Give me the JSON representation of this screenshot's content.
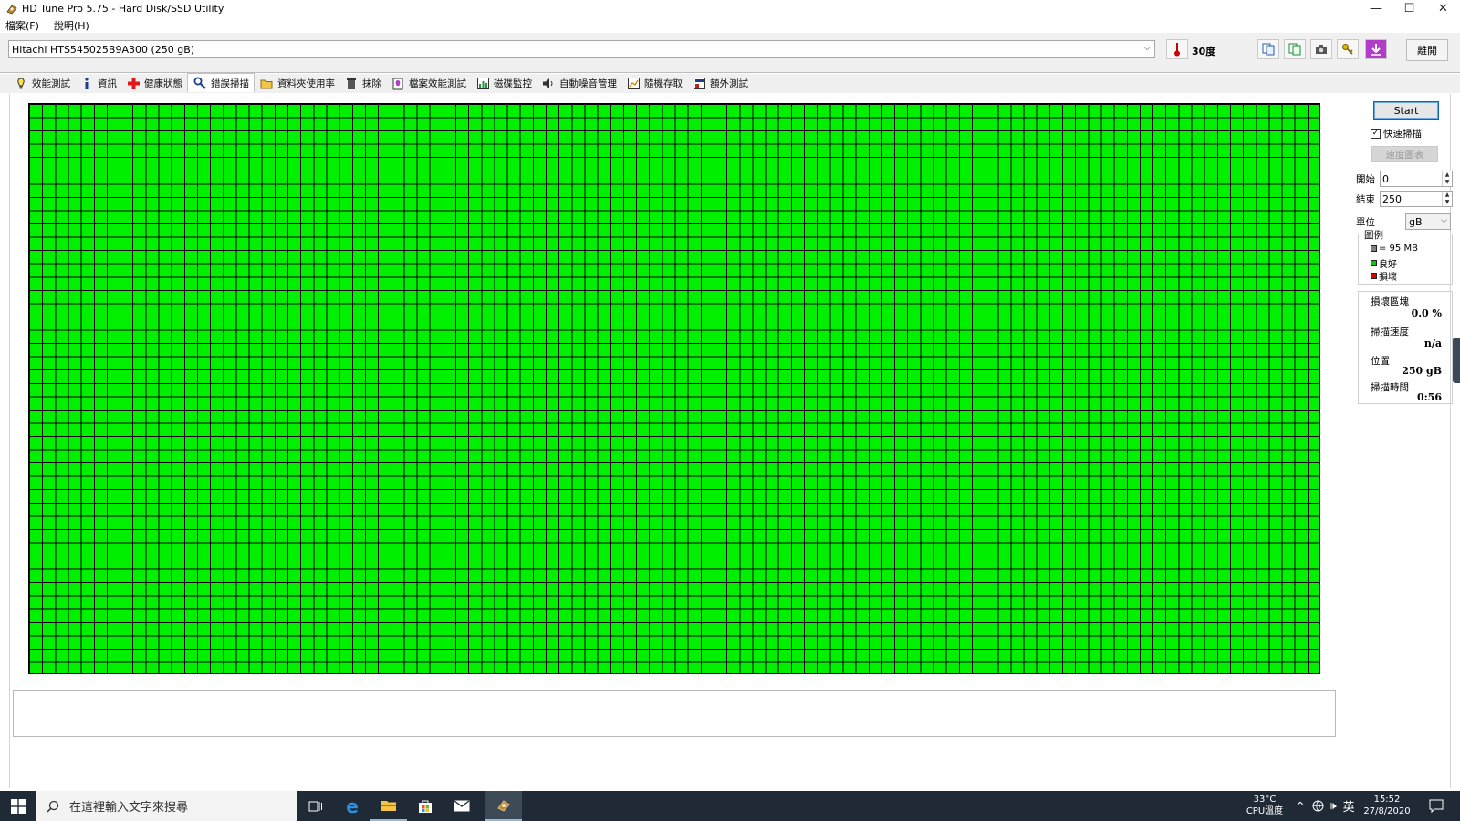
{
  "window": {
    "title": "HD Tune Pro 5.75 - Hard Disk/SSD Utility",
    "controls": [
      "—",
      "☐",
      "✕"
    ]
  },
  "menu": [
    {
      "label": "檔案(F)"
    },
    {
      "label": "說明(H)"
    }
  ],
  "toolbar": {
    "drive": "Hitachi HTS545025B9A300 (250 gB)",
    "temperature": "30度",
    "exit_label": "離開"
  },
  "tabs": [
    {
      "label": "效能測試",
      "icon": "benchmark-icon"
    },
    {
      "label": "資訊",
      "icon": "info-icon"
    },
    {
      "label": "健康狀態",
      "icon": "health-icon"
    },
    {
      "label": "錯誤掃描",
      "icon": "error-scan-icon",
      "active": true
    },
    {
      "label": "資料夾使用率",
      "icon": "folder-icon"
    },
    {
      "label": "抹除",
      "icon": "erase-icon"
    },
    {
      "label": "檔案效能測試",
      "icon": "file-benchmark-icon"
    },
    {
      "label": "磁碟監控",
      "icon": "disk-monitor-icon"
    },
    {
      "label": "自動噪音管理",
      "icon": "aam-icon"
    },
    {
      "label": "隨機存取",
      "icon": "random-access-icon"
    },
    {
      "label": "額外測試",
      "icon": "extra-tests-icon"
    }
  ],
  "scan": {
    "start_label": "Start",
    "quick_scan_label": "快速掃描",
    "quick_scan_checked": true,
    "speed_map_label": "速度圖表",
    "start_field_label": "開始",
    "start_value": "0",
    "end_field_label": "結束",
    "end_value": "250",
    "unit_label": "單位",
    "unit_value": "gB",
    "legend_title": "圖例",
    "legend": [
      {
        "label": "= 95 MB",
        "color": "#808080"
      },
      {
        "label": "良好",
        "color": "#00d000"
      },
      {
        "label": "損壞",
        "color": "#e00000"
      }
    ],
    "stats": {
      "damaged_label": "損壞區塊",
      "damaged_value": "0.0 %",
      "speed_label": "掃描速度",
      "speed_value": "n/a",
      "position_label": "位置",
      "position_value": "250 gB",
      "time_label": "掃描時間",
      "time_value": "0:56"
    },
    "grid_color": "#00f000"
  },
  "taskbar": {
    "search_placeholder": "在這裡輸入文字來搜尋",
    "cpu_temp": "33°C",
    "cpu_temp_label": "CPU溫度",
    "ime": "英",
    "time": "15:52",
    "date": "27/8/2020"
  }
}
